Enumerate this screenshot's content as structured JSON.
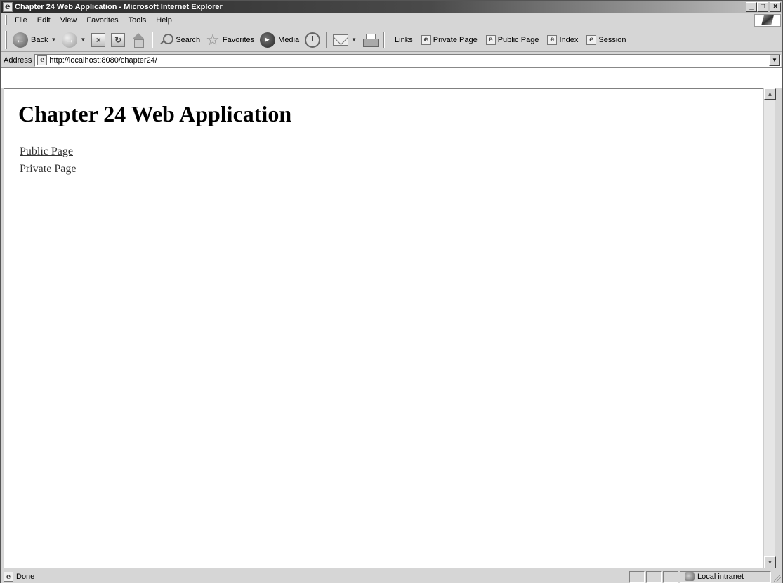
{
  "window": {
    "title": "Chapter 24 Web Application - Microsoft Internet Explorer",
    "controls": {
      "minimize": "_",
      "maximize": "□",
      "close": "×"
    }
  },
  "menubar": {
    "items": [
      {
        "label": "File",
        "accel": "F"
      },
      {
        "label": "Edit",
        "accel": "E"
      },
      {
        "label": "View",
        "accel": "V"
      },
      {
        "label": "Favorites",
        "accel": "a"
      },
      {
        "label": "Tools",
        "accel": "T"
      },
      {
        "label": "Help",
        "accel": "H"
      }
    ]
  },
  "toolbar": {
    "back_label": "Back",
    "search_label": "Search",
    "favorites_label": "Favorites",
    "media_label": "Media",
    "links_label": "Links",
    "links": [
      "Private Page",
      "Public Page",
      "Index",
      "Session"
    ]
  },
  "address": {
    "label": "Address",
    "accel": "d",
    "value": "http://localhost:8080/chapter24/"
  },
  "page": {
    "heading": "Chapter 24 Web Application",
    "links": [
      "Public Page",
      "Private Page"
    ]
  },
  "status": {
    "text": "Done",
    "zone": "Local intranet"
  },
  "icons": {
    "app": "ie-page-icon",
    "back": "back-arrow-icon",
    "forward": "forward-arrow-icon",
    "stop": "stop-icon",
    "refresh": "refresh-icon",
    "home": "home-icon",
    "search": "search-icon",
    "favorites": "star-icon",
    "media": "media-icon",
    "history": "history-icon",
    "mail": "mail-icon",
    "print": "print-icon"
  }
}
